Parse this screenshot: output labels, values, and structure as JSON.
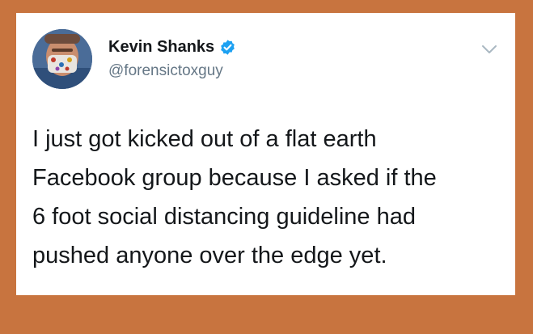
{
  "tweet": {
    "author": {
      "display_name": "Kevin Shanks",
      "handle": "@forensictoxguy",
      "verified": true
    },
    "text_lines": [
      "I just got kicked out of a flat earth",
      "Facebook group because I asked if the",
      "6 foot social distancing guideline had",
      "pushed anyone over the edge yet."
    ]
  },
  "colors": {
    "background": "#c8743f",
    "card": "#ffffff",
    "text": "#14171a",
    "handle": "#657786",
    "verified": "#1da1f2"
  },
  "icons": {
    "verified": "verified-badge-icon",
    "menu": "chevron-down-icon"
  }
}
